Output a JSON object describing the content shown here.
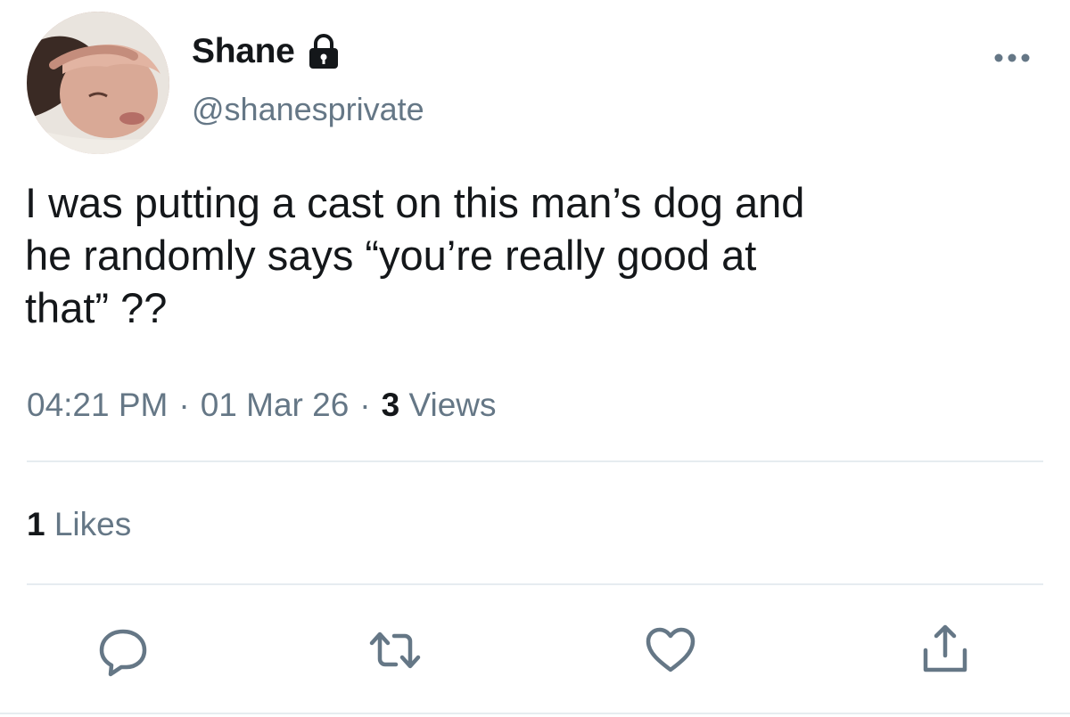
{
  "user": {
    "display_name": "Shane",
    "handle": "@shanesprivate",
    "protected_icon": "lock-icon",
    "avatar": "profile-photo"
  },
  "tweet": {
    "text": "I was putting a cast on this man’s dog and\nhe randomly says “you’re really good at\nthat” ??",
    "time": "04:21 PM",
    "separator": "·",
    "date": "01 Mar 26",
    "views_count": "3",
    "views_label": " Views"
  },
  "stats": {
    "likes_count": "1",
    "likes_label": " Likes"
  },
  "actions": {
    "more": "more-icon",
    "reply": "reply-icon",
    "retweet": "retweet-icon",
    "like": "heart-icon",
    "share": "share-icon"
  },
  "colors": {
    "text": "#14171a",
    "secondary": "#657786",
    "divider": "#e6ecf0"
  }
}
